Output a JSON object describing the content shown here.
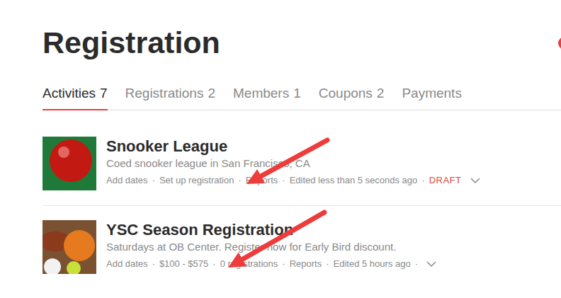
{
  "page": {
    "title": "Registration"
  },
  "tabs": [
    {
      "label": "Activities",
      "count": "7",
      "selected": true
    },
    {
      "label": "Registrations",
      "count": "2",
      "selected": false
    },
    {
      "label": "Members",
      "count": "1",
      "selected": false
    },
    {
      "label": "Coupons",
      "count": "2",
      "selected": false
    },
    {
      "label": "Payments",
      "selected": false
    }
  ],
  "separator": "·",
  "activities": [
    {
      "title": "Snooker League",
      "description": "Coed snooker league in San Francisco, CA",
      "color": "#1f7a3a",
      "meta": [
        {
          "text": "Add dates",
          "kind": "link"
        },
        {
          "text": "Set up registration",
          "kind": "link"
        },
        {
          "text": "Reports",
          "kind": "link"
        },
        {
          "text": "Edited less than 5 seconds ago",
          "kind": "text"
        },
        {
          "text": "DRAFT",
          "kind": "status"
        }
      ],
      "trailing_separator": false
    },
    {
      "title": "YSC Season Registration",
      "description": "Saturdays at OB Center. Register now for Early Bird discount.",
      "color": "#7a5232",
      "meta": [
        {
          "text": "Add dates",
          "kind": "link"
        },
        {
          "text": "$100 - $575",
          "kind": "link"
        },
        {
          "text": "0 registrations",
          "kind": "link"
        },
        {
          "text": "Reports",
          "kind": "link"
        },
        {
          "text": "Edited 5 hours ago",
          "kind": "text"
        }
      ],
      "trailing_separator": true
    }
  ]
}
